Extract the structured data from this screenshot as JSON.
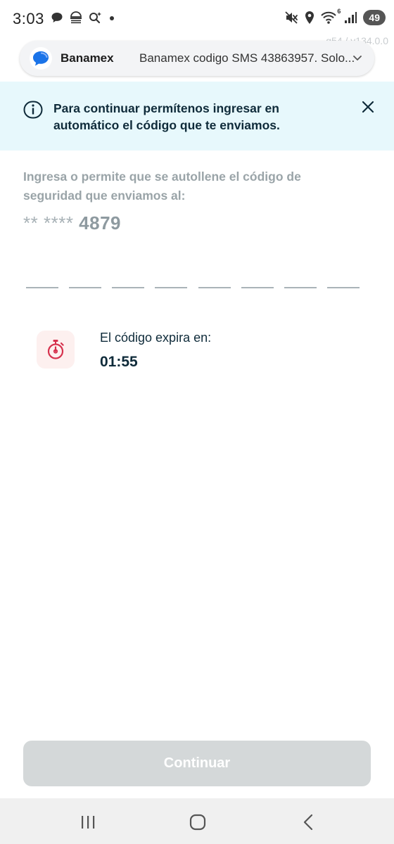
{
  "status_bar": {
    "time": "3:03",
    "left_icons": [
      "chat-bubble-icon",
      "hatch-icon",
      "search-sparkle-icon",
      "dot-icon"
    ],
    "right_icons": [
      "mute-icon",
      "location-icon",
      "wifi-6-icon",
      "signal-icon"
    ],
    "wifi_label": "6",
    "battery": "49",
    "watermark": "g54 / v134.0.0"
  },
  "notification": {
    "app_name": "Banamex",
    "message": "Banamex codigo SMS 43863957. Solo...",
    "app_icon": "messages-icon",
    "expand_icon": "chevron-down-icon"
  },
  "info_banner": {
    "text": "Para continuar permítenos ingresar en automático el código que te enviamos.",
    "icon": "info-icon",
    "close_icon": "close-icon",
    "background": "#e7f8fc"
  },
  "content": {
    "instruction": "Ingresa o permite que se autollene el código de seguridad que enviamos al:",
    "phone_mask_prefix": "** ****",
    "phone_mask_suffix": "4879",
    "code_slots": [
      "",
      "",
      "",
      "",
      "",
      "",
      "",
      ""
    ],
    "timer_label": "El código expira en:",
    "timer_value": "01:55",
    "timer_icon": "stopwatch-icon",
    "accent_color": "#d6314d"
  },
  "continue_button": {
    "label": "Continuar",
    "disabled": true,
    "color": "#d4d8d9"
  },
  "nav_bar": {
    "buttons": [
      "recent-apps-icon",
      "home-icon",
      "back-icon"
    ]
  }
}
